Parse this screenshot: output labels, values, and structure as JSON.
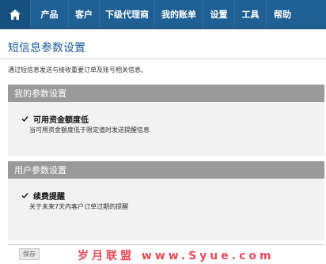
{
  "nav": {
    "home_icon": "home-icon",
    "items": [
      "产品",
      "客户",
      "下级代理商",
      "我的账单",
      "设置",
      "工具",
      "帮助"
    ]
  },
  "page": {
    "title": "短信息参数设置",
    "description": "通过短信息发送与接收重要订单及账号相关信息。"
  },
  "sections": [
    {
      "header": "我的参数设置",
      "option_label": "可用资金额度低",
      "option_help": "当可用资金额度低于限定值时发送提醒信息",
      "checked": true
    },
    {
      "header": "用户参数设置",
      "option_label": "续费提醒",
      "option_help": "关于未来7天内客户订单过期的提醒",
      "checked": true
    }
  ],
  "footer": {
    "save_label": "保存",
    "watermark": "岁月联盟 www.Syue.com"
  },
  "colors": {
    "nav_bg": "#1f5f94",
    "title_blue": "#1a5a98",
    "panel_header": "#9a9a9a",
    "panel_bg": "#f2f2f2",
    "watermark_red": "#e74b59"
  }
}
